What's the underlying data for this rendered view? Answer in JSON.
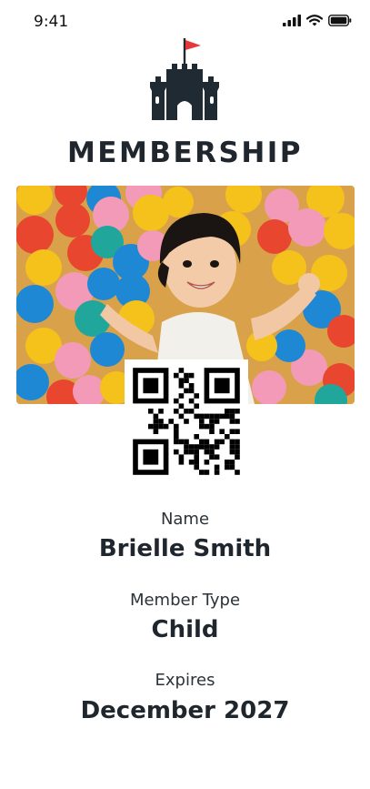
{
  "status_bar": {
    "time": "9:41",
    "icons": [
      "signal-icon",
      "wifi-icon",
      "battery-icon"
    ]
  },
  "header": {
    "logo": "castle-icon",
    "flag_color": "#e63838",
    "logo_color": "#1f2a33",
    "title": "MEMBERSHIP"
  },
  "member_photo": {
    "description_icon": "child-photo"
  },
  "qr_code": {
    "icon": "qr-code-icon"
  },
  "details": [
    {
      "label": "Name",
      "value": "Brielle Smith"
    },
    {
      "label": "Member Type",
      "value": "Child"
    },
    {
      "label": "Expires",
      "value": "December 2027"
    }
  ]
}
